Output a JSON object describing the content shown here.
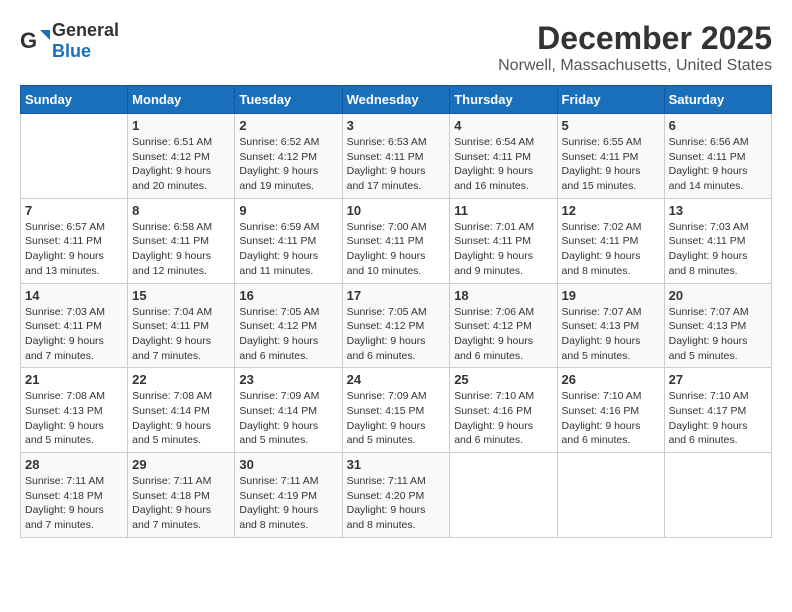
{
  "logo": {
    "general": "General",
    "blue": "Blue"
  },
  "title": "December 2025",
  "location": "Norwell, Massachusetts, United States",
  "headers": [
    "Sunday",
    "Monday",
    "Tuesday",
    "Wednesday",
    "Thursday",
    "Friday",
    "Saturday"
  ],
  "weeks": [
    [
      {
        "day": "",
        "info": ""
      },
      {
        "day": "1",
        "info": "Sunrise: 6:51 AM\nSunset: 4:12 PM\nDaylight: 9 hours\nand 20 minutes."
      },
      {
        "day": "2",
        "info": "Sunrise: 6:52 AM\nSunset: 4:12 PM\nDaylight: 9 hours\nand 19 minutes."
      },
      {
        "day": "3",
        "info": "Sunrise: 6:53 AM\nSunset: 4:11 PM\nDaylight: 9 hours\nand 17 minutes."
      },
      {
        "day": "4",
        "info": "Sunrise: 6:54 AM\nSunset: 4:11 PM\nDaylight: 9 hours\nand 16 minutes."
      },
      {
        "day": "5",
        "info": "Sunrise: 6:55 AM\nSunset: 4:11 PM\nDaylight: 9 hours\nand 15 minutes."
      },
      {
        "day": "6",
        "info": "Sunrise: 6:56 AM\nSunset: 4:11 PM\nDaylight: 9 hours\nand 14 minutes."
      }
    ],
    [
      {
        "day": "7",
        "info": "Sunrise: 6:57 AM\nSunset: 4:11 PM\nDaylight: 9 hours\nand 13 minutes."
      },
      {
        "day": "8",
        "info": "Sunrise: 6:58 AM\nSunset: 4:11 PM\nDaylight: 9 hours\nand 12 minutes."
      },
      {
        "day": "9",
        "info": "Sunrise: 6:59 AM\nSunset: 4:11 PM\nDaylight: 9 hours\nand 11 minutes."
      },
      {
        "day": "10",
        "info": "Sunrise: 7:00 AM\nSunset: 4:11 PM\nDaylight: 9 hours\nand 10 minutes."
      },
      {
        "day": "11",
        "info": "Sunrise: 7:01 AM\nSunset: 4:11 PM\nDaylight: 9 hours\nand 9 minutes."
      },
      {
        "day": "12",
        "info": "Sunrise: 7:02 AM\nSunset: 4:11 PM\nDaylight: 9 hours\nand 8 minutes."
      },
      {
        "day": "13",
        "info": "Sunrise: 7:03 AM\nSunset: 4:11 PM\nDaylight: 9 hours\nand 8 minutes."
      }
    ],
    [
      {
        "day": "14",
        "info": "Sunrise: 7:03 AM\nSunset: 4:11 PM\nDaylight: 9 hours\nand 7 minutes."
      },
      {
        "day": "15",
        "info": "Sunrise: 7:04 AM\nSunset: 4:11 PM\nDaylight: 9 hours\nand 7 minutes."
      },
      {
        "day": "16",
        "info": "Sunrise: 7:05 AM\nSunset: 4:12 PM\nDaylight: 9 hours\nand 6 minutes."
      },
      {
        "day": "17",
        "info": "Sunrise: 7:05 AM\nSunset: 4:12 PM\nDaylight: 9 hours\nand 6 minutes."
      },
      {
        "day": "18",
        "info": "Sunrise: 7:06 AM\nSunset: 4:12 PM\nDaylight: 9 hours\nand 6 minutes."
      },
      {
        "day": "19",
        "info": "Sunrise: 7:07 AM\nSunset: 4:13 PM\nDaylight: 9 hours\nand 5 minutes."
      },
      {
        "day": "20",
        "info": "Sunrise: 7:07 AM\nSunset: 4:13 PM\nDaylight: 9 hours\nand 5 minutes."
      }
    ],
    [
      {
        "day": "21",
        "info": "Sunrise: 7:08 AM\nSunset: 4:13 PM\nDaylight: 9 hours\nand 5 minutes."
      },
      {
        "day": "22",
        "info": "Sunrise: 7:08 AM\nSunset: 4:14 PM\nDaylight: 9 hours\nand 5 minutes."
      },
      {
        "day": "23",
        "info": "Sunrise: 7:09 AM\nSunset: 4:14 PM\nDaylight: 9 hours\nand 5 minutes."
      },
      {
        "day": "24",
        "info": "Sunrise: 7:09 AM\nSunset: 4:15 PM\nDaylight: 9 hours\nand 5 minutes."
      },
      {
        "day": "25",
        "info": "Sunrise: 7:10 AM\nSunset: 4:16 PM\nDaylight: 9 hours\nand 6 minutes."
      },
      {
        "day": "26",
        "info": "Sunrise: 7:10 AM\nSunset: 4:16 PM\nDaylight: 9 hours\nand 6 minutes."
      },
      {
        "day": "27",
        "info": "Sunrise: 7:10 AM\nSunset: 4:17 PM\nDaylight: 9 hours\nand 6 minutes."
      }
    ],
    [
      {
        "day": "28",
        "info": "Sunrise: 7:11 AM\nSunset: 4:18 PM\nDaylight: 9 hours\nand 7 minutes."
      },
      {
        "day": "29",
        "info": "Sunrise: 7:11 AM\nSunset: 4:18 PM\nDaylight: 9 hours\nand 7 minutes."
      },
      {
        "day": "30",
        "info": "Sunrise: 7:11 AM\nSunset: 4:19 PM\nDaylight: 9 hours\nand 8 minutes."
      },
      {
        "day": "31",
        "info": "Sunrise: 7:11 AM\nSunset: 4:20 PM\nDaylight: 9 hours\nand 8 minutes."
      },
      {
        "day": "",
        "info": ""
      },
      {
        "day": "",
        "info": ""
      },
      {
        "day": "",
        "info": ""
      }
    ]
  ]
}
